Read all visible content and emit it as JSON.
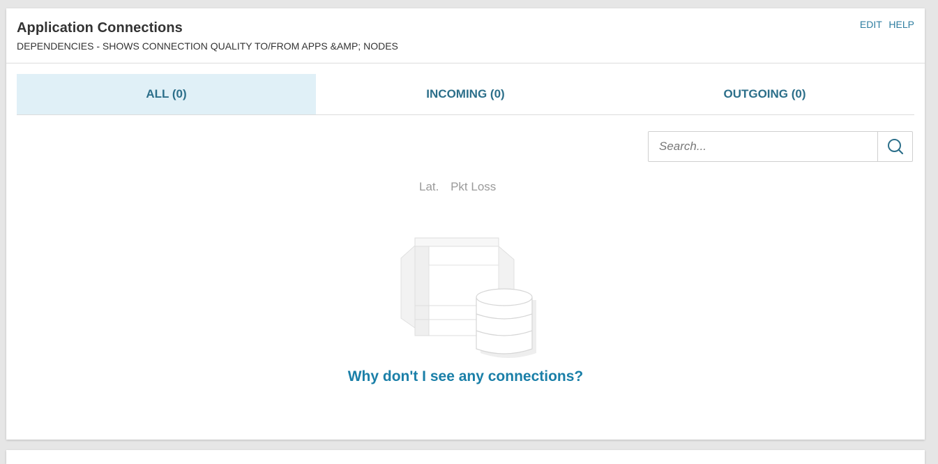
{
  "header": {
    "title": "Application Connections",
    "subtitle": "DEPENDENCIES - SHOWS CONNECTION QUALITY TO/FROM APPS &AMP; NODES",
    "edit_label": "EDIT",
    "help_label": "HELP"
  },
  "tabs": [
    {
      "label": "ALL (0)",
      "active": true
    },
    {
      "label": "INCOMING (0)",
      "active": false
    },
    {
      "label": "OUTGOING (0)",
      "active": false
    }
  ],
  "search": {
    "placeholder": "Search...",
    "value": ""
  },
  "columns": {
    "latency": "Lat.",
    "packet_loss": "Pkt Loss"
  },
  "empty_state": {
    "link_text": "Why don't I see any connections?",
    "illustration": "server-database-icon"
  },
  "colors": {
    "accent": "#2f7ea0",
    "tab_active_bg": "#e0f0f7",
    "link": "#1a7fa8"
  }
}
